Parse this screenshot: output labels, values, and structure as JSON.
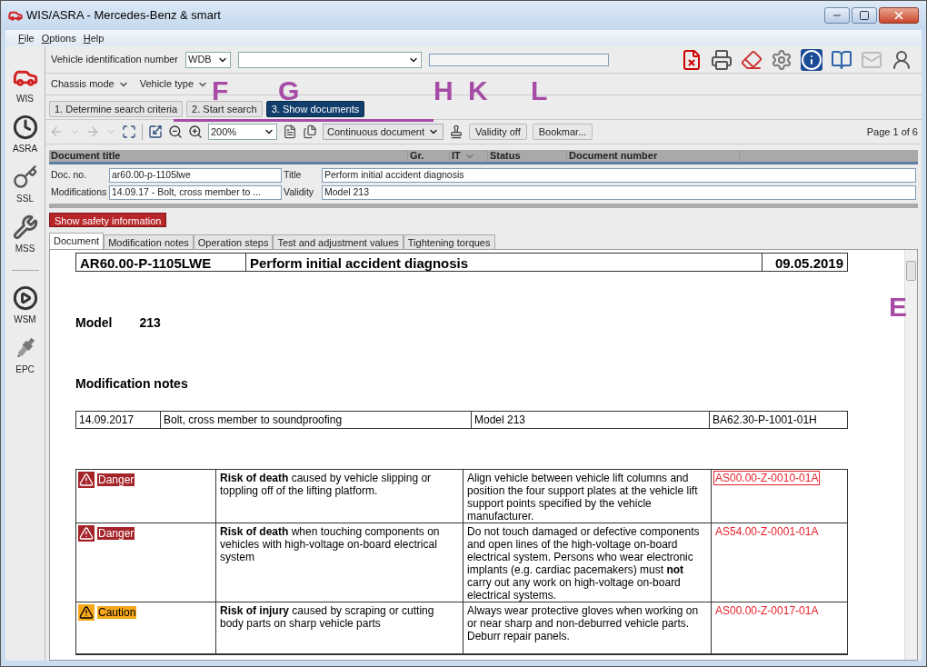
{
  "window": {
    "title": "WIS/ASRA - Mercedes-Benz & smart"
  },
  "menu": [
    "File",
    "Options",
    "Help"
  ],
  "sidebar": [
    {
      "label": "WIS",
      "kind": "car"
    },
    {
      "label": "ASRA",
      "kind": "clock"
    },
    {
      "label": "SSL",
      "kind": "key"
    },
    {
      "label": "MSS",
      "kind": "wrench"
    },
    {
      "label": "WSM",
      "kind": "play"
    },
    {
      "label": "EPC",
      "kind": "plug"
    }
  ],
  "vin": {
    "label": "Vehicle identification number",
    "prefix": "WDB"
  },
  "chassis": [
    "Chassis mode",
    "Vehicle type"
  ],
  "steps": [
    {
      "label": "1. Determine search criteria",
      "selected": false
    },
    {
      "label": "2. Start search",
      "selected": false
    },
    {
      "label": "3. Show documents",
      "selected": true
    }
  ],
  "toolbar": {
    "zoom": "200%",
    "view": "Continuous document",
    "buttons": [
      "Validity off",
      "Bookmar..."
    ],
    "page": "Page 1 of 6"
  },
  "columns": [
    "Document title",
    "Gr.",
    "IT",
    "Status",
    "Document number"
  ],
  "info": [
    {
      "label": "Doc. no.",
      "value": "ar60.00-p-1105lwe"
    },
    {
      "label": "Title",
      "value": "Perform initial accident diagnosis"
    },
    {
      "label": "Modifications",
      "value": "14.09.17 - Bolt, cross member to  ..."
    },
    {
      "label": "Validity",
      "value": "Model 213"
    }
  ],
  "safety_button": "Show safety information",
  "tabs": [
    {
      "label": "Document",
      "selected": true
    },
    {
      "label": "Modification notes",
      "selected": false
    },
    {
      "label": "Operation steps",
      "selected": false
    },
    {
      "label": "Test and adjustment values",
      "selected": false
    },
    {
      "label": "Tightening torques",
      "selected": false
    }
  ],
  "document": {
    "code": "AR60.00-P-1105LWE",
    "title": "Perform initial accident diagnosis",
    "date": "09.05.2019",
    "model_label": "Model",
    "model": "213",
    "notes_heading": "Modification notes",
    "notes": [
      [
        "14.09.2017",
        "Bolt, cross member to soundproofing",
        "Model 213",
        "BA62.30-P-1001-01H"
      ]
    ],
    "hazards": [
      {
        "kind": "danger",
        "label": "Danger",
        "risk": "**Risk of death** caused by vehicle slipping or toppling off of the lifting platform.",
        "measure": "Align vehicle between vehicle lift columns and position the four support plates at the vehicle lift support points specified by the vehicle manufacturer.",
        "ref": "AS00.00-Z-0010-01A",
        "selected": true
      },
      {
        "kind": "danger",
        "label": "Danger",
        "risk": "**Risk of death** when touching components on vehicles with high-voltage on-board electrical system",
        "measure": "Do not touch damaged or defective components and open lines of the high-voltage on-board electrical system. Persons who wear electronic implants (e.g. cardiac pacemakers) must **not** carry out any work on high-voltage on-board electrical systems.",
        "ref": "AS54.00-Z-0001-01A",
        "selected": false
      },
      {
        "kind": "caution",
        "label": "Caution",
        "risk": "**Risk of injury** caused by scraping or cutting body parts on sharp vehicle parts",
        "measure": "Always wear protective gloves when working on or near sharp and non-deburred vehicle parts. Deburr repair panels.",
        "ref": "AS00.00-Z-0017-01A",
        "selected": false
      }
    ]
  },
  "callouts": [
    "F",
    "G",
    "H",
    "K",
    "L",
    "E"
  ]
}
